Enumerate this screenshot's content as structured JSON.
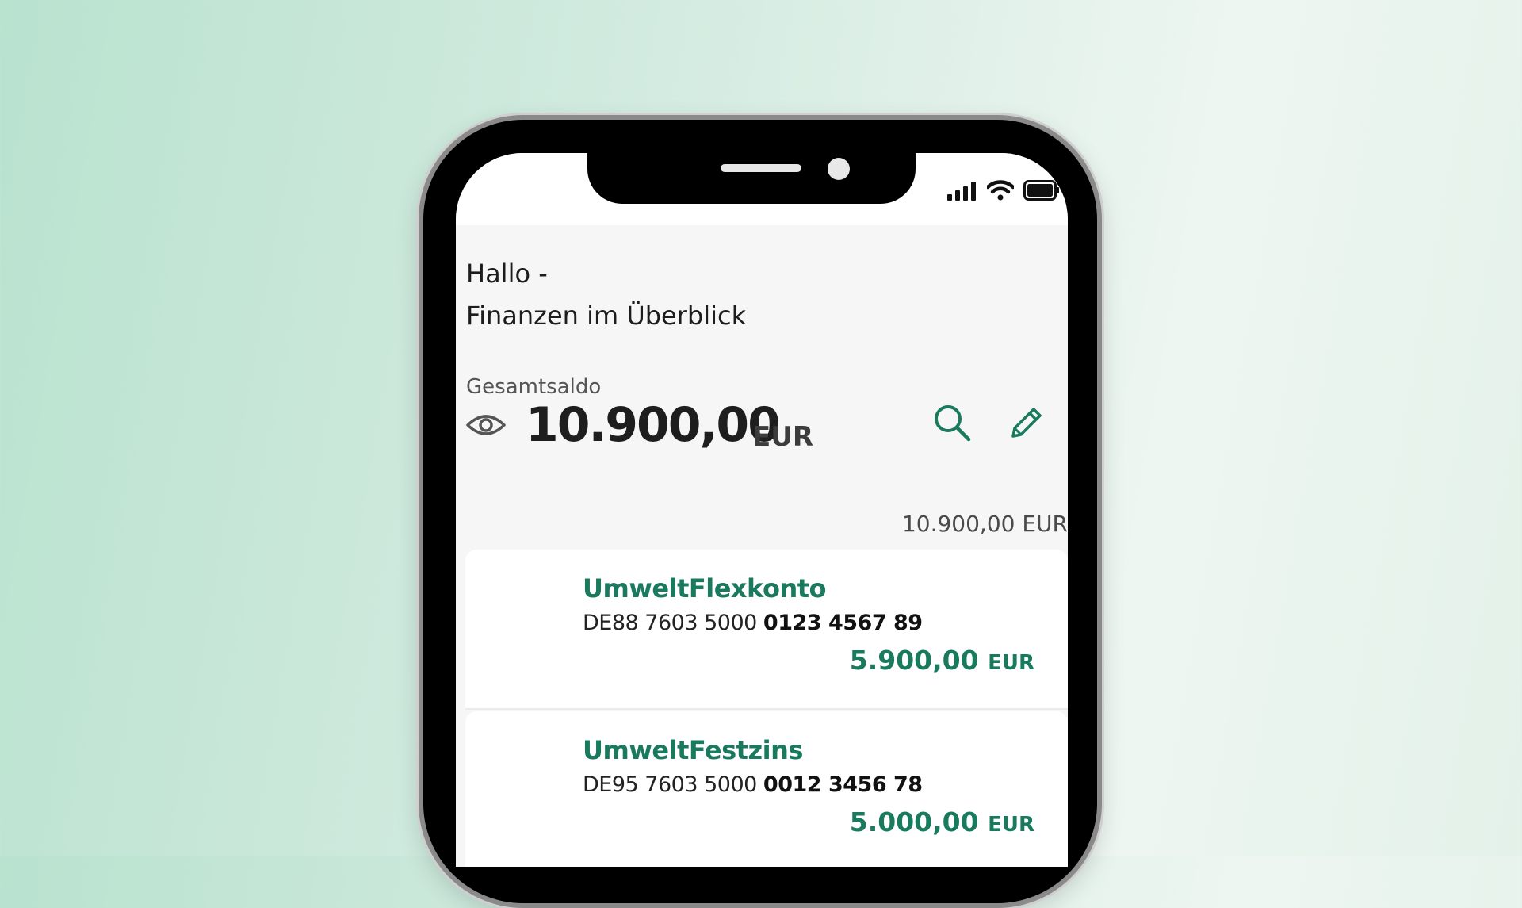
{
  "greeting": {
    "line1": "Hallo -",
    "line2": "Finanzen im Überblick"
  },
  "balance": {
    "label": "Gesamtsaldo",
    "amount": "10.900,00",
    "currency": "EUR",
    "subtotal": "10.900,00 EUR"
  },
  "accounts": [
    {
      "name": "UmweltFlexkonto",
      "iban_prefix": "DE88 7603 5000",
      "iban_number": "0123 4567 89",
      "amount": "5.900,00",
      "currency": "EUR"
    },
    {
      "name": "UmweltFestzins",
      "iban_prefix": "DE95 7603 5000",
      "iban_number": "0012 3456 78",
      "amount": "5.000,00",
      "currency": "EUR"
    }
  ],
  "colors": {
    "accent": "#1a7a5e",
    "background_start": "#b9e2cf",
    "screen": "#f6f6f6"
  },
  "icons": [
    "eye-icon",
    "search-icon",
    "edit-pencil-icon",
    "signal-icon",
    "wifi-icon",
    "battery-icon"
  ]
}
